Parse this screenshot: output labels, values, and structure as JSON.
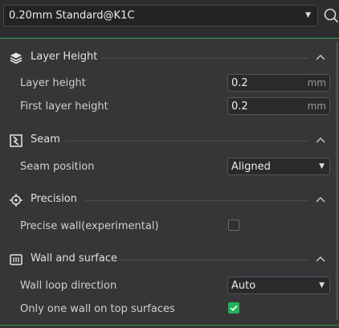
{
  "preset": {
    "value": "0.20mm Standard@K1C"
  },
  "sections": [
    {
      "title": "Layer Height",
      "rows": [
        {
          "label": "Layer height",
          "value": "0.2",
          "unit": "mm"
        },
        {
          "label": "First layer height",
          "value": "0.2",
          "unit": "mm"
        }
      ]
    },
    {
      "title": "Seam",
      "rows": [
        {
          "label": "Seam position",
          "value": "Aligned"
        }
      ]
    },
    {
      "title": "Precision",
      "rows": [
        {
          "label": "Precise wall(experimental)",
          "checked": false
        }
      ]
    },
    {
      "title": "Wall and surface",
      "rows": [
        {
          "label": "Wall loop direction",
          "value": "Auto"
        },
        {
          "label": "Only one wall on top surfaces",
          "checked": true
        }
      ]
    }
  ],
  "colors": {
    "accent": "#1fb457",
    "divider": "#2f9e50",
    "panel": "#363638"
  }
}
